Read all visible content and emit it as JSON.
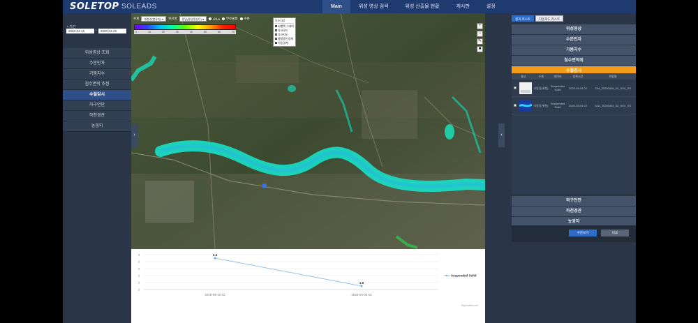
{
  "header": {
    "logo": "SOLETOP",
    "logo_sub": "SOLEADS",
    "nav": [
      "Main",
      "위성 영상 검색",
      "위성 산출물 현황",
      "게시판",
      "설정"
    ]
  },
  "left": {
    "period_label": "기간",
    "date_from": "2020-04-15",
    "date_to": "2020-04-28",
    "date_sep": "~",
    "menu": [
      "위성영상 조회",
      "수문인자",
      "가뭄지수",
      "침수면적 추정",
      "수질감시",
      "하구언안",
      "하천경관",
      "농경지"
    ],
    "active_index": 4
  },
  "map": {
    "toolbar": {
      "basin_label": "수계",
      "basin_value": "대청경(방유리)",
      "point_label": "위치명",
      "point_value": "용담(용담댐상단)",
      "radios": [
        "chl-a",
        "부유물질",
        "수온"
      ]
    },
    "colorbar_ticks": [
      "0",
      "10",
      "20",
      "30",
      "40",
      "50",
      "60",
      "70"
    ],
    "layers": {
      "title": "보조자료",
      "items": [
        "씨행쪽 그레이",
        "다크모드",
        "다크지도",
        "행정동인경계",
        "이동경계"
      ]
    },
    "tools": [
      "+",
      "−",
      "✎",
      "■"
    ]
  },
  "chart": {
    "watermark": "Highcharts.com"
  },
  "chart_data": {
    "type": "line",
    "x": [
      "2019-05-10 02",
      "2020-04-04 02"
    ],
    "series": [
      {
        "name": "Suspended Solid",
        "values": [
          2.4,
          1.6
        ]
      }
    ],
    "data_labels": [
      "2.4",
      "1.6"
    ],
    "y_ticks": [
      "3",
      "2",
      "2",
      "2",
      "2",
      "2"
    ],
    "legend": "right",
    "grid": true
  },
  "right": {
    "tabs": [
      "결과 리스트",
      "다운로드 리스트"
    ],
    "items_top": [
      "위성영상",
      "수문인자",
      "가뭄지수",
      "침수면적위",
      "수질감시"
    ],
    "active_item": "수질감시",
    "table": {
      "headers": [
        "영상",
        "수계",
        "데이터",
        "등록시간",
        "파일명"
      ],
      "rows": [
        {
          "basin": "낙동강(위천)",
          "data": "Suspended Solid",
          "time": "2020-04-04 02",
          "file": "S2A_20200404_02_SSX_SS",
          "checked": true
        },
        {
          "basin": "낙동강(위천)",
          "data": "Suspended Solid",
          "time": "2020-04-04 02",
          "file": "S2A_20200404_02_SSX_SS",
          "checked": false
        }
      ]
    },
    "items_bottom": [
      "하구언안",
      "하천경관",
      "농경지"
    ],
    "buttons": {
      "primary": "수문보기",
      "secondary": "비교"
    }
  },
  "colors": {
    "header_bg": "#1e3a6e",
    "active": "#2f4f88",
    "accent_orange": "#f49b18",
    "button_blue": "#2f6cc8",
    "river": "#20d8c8",
    "series": "#7fb2e5"
  }
}
